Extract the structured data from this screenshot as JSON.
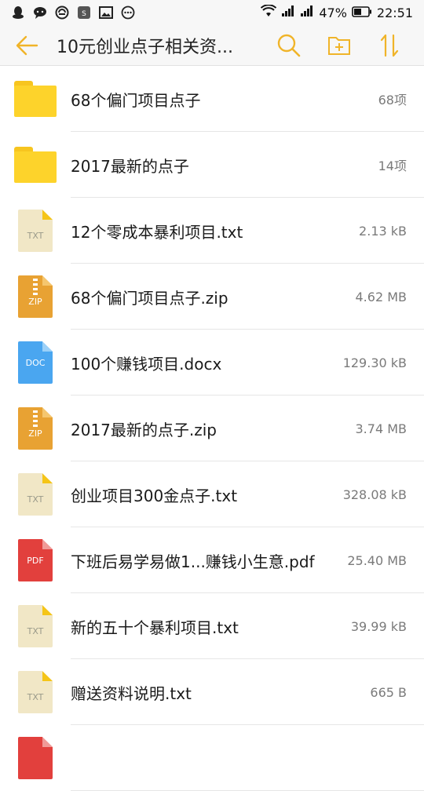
{
  "status_bar": {
    "battery_percent": "47%",
    "time": "22:51",
    "left_icons": [
      "qq-icon",
      "wechat-icon",
      "sync-icon",
      "app-icon",
      "image-icon",
      "more-icon"
    ]
  },
  "toolbar": {
    "title": "10元创业点子相关资...",
    "icons": [
      "back-arrow-icon",
      "search-icon",
      "new-folder-icon",
      "sort-icon"
    ],
    "accent_color": "#f0b429"
  },
  "files": [
    {
      "type": "folder",
      "name": "68个偏门项目点子",
      "meta": "68项"
    },
    {
      "type": "folder",
      "name": "2017最新的点子",
      "meta": "14项"
    },
    {
      "type": "txt",
      "badge": "TXT",
      "name": "12个零成本暴利项目.txt",
      "meta": "2.13 kB"
    },
    {
      "type": "zip",
      "badge": "ZIP",
      "name": "68个偏门项目点子.zip",
      "meta": "4.62 MB"
    },
    {
      "type": "doc",
      "badge": "DOC",
      "name": "100个赚钱项目.docx",
      "meta": "129.30 kB"
    },
    {
      "type": "zip",
      "badge": "ZIP",
      "name": "2017最新的点子.zip",
      "meta": "3.74 MB"
    },
    {
      "type": "txt",
      "badge": "TXT",
      "name": "创业项目300金点子.txt",
      "meta": "328.08 kB"
    },
    {
      "type": "pdf",
      "badge": "PDF",
      "name": "下班后易学易做1...赚钱小生意.pdf",
      "meta": "25.40 MB"
    },
    {
      "type": "txt",
      "badge": "TXT",
      "name": "新的五十个暴利项目.txt",
      "meta": "39.99 kB"
    },
    {
      "type": "txt",
      "badge": "TXT",
      "name": "赠送资料说明.txt",
      "meta": "665 B"
    }
  ]
}
